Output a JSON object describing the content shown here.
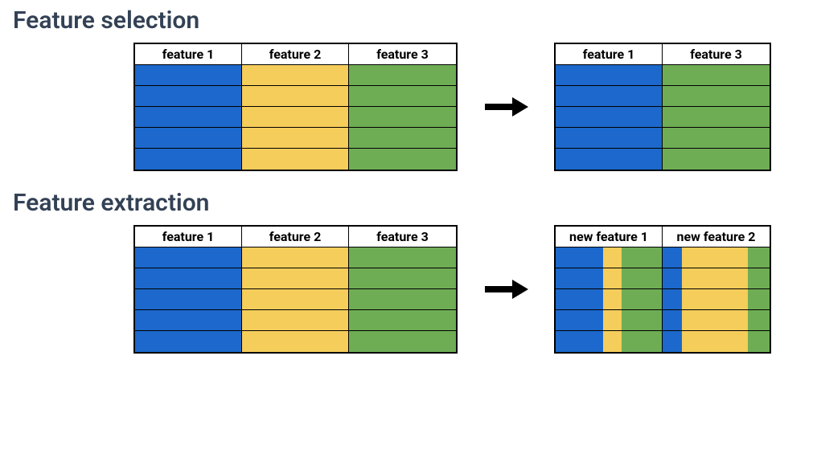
{
  "colors": {
    "blue": "#1C68CC",
    "yellow": "#F5CD5B",
    "green": "#6FAD55"
  },
  "chart_data": {
    "type": "table",
    "rows": 5,
    "sections": [
      {
        "title": "Feature selection",
        "left_table": {
          "columns": [
            {
              "header": "feature 1",
              "fill": [
                {
                  "color": "blue",
                  "start": 0,
                  "end": 1
                }
              ]
            },
            {
              "header": "feature 2",
              "fill": [
                {
                  "color": "yellow",
                  "start": 0,
                  "end": 1
                }
              ]
            },
            {
              "header": "feature 3",
              "fill": [
                {
                  "color": "green",
                  "start": 0,
                  "end": 1
                }
              ]
            }
          ]
        },
        "right_table": {
          "columns": [
            {
              "header": "feature 1",
              "fill": [
                {
                  "color": "blue",
                  "start": 0,
                  "end": 1
                }
              ]
            },
            {
              "header": "feature 3",
              "fill": [
                {
                  "color": "green",
                  "start": 0,
                  "end": 1
                }
              ]
            }
          ]
        }
      },
      {
        "title": "Feature extraction",
        "left_table": {
          "columns": [
            {
              "header": "feature 1",
              "fill": [
                {
                  "color": "blue",
                  "start": 0,
                  "end": 1
                }
              ]
            },
            {
              "header": "feature 2",
              "fill": [
                {
                  "color": "yellow",
                  "start": 0,
                  "end": 1
                }
              ]
            },
            {
              "header": "feature 3",
              "fill": [
                {
                  "color": "green",
                  "start": 0,
                  "end": 1
                }
              ]
            }
          ]
        },
        "right_table": {
          "columns": [
            {
              "header": "new feature 1",
              "fill": [
                {
                  "color": "blue",
                  "start": 0.0,
                  "end": 0.45
                },
                {
                  "color": "yellow",
                  "start": 0.45,
                  "end": 0.62
                },
                {
                  "color": "green",
                  "start": 0.62,
                  "end": 1.0
                }
              ]
            },
            {
              "header": "new feature 2",
              "fill": [
                {
                  "color": "blue",
                  "start": 0.0,
                  "end": 0.18
                },
                {
                  "color": "yellow",
                  "start": 0.18,
                  "end": 0.8
                },
                {
                  "color": "green",
                  "start": 0.8,
                  "end": 1.0
                }
              ]
            }
          ]
        }
      }
    ]
  }
}
